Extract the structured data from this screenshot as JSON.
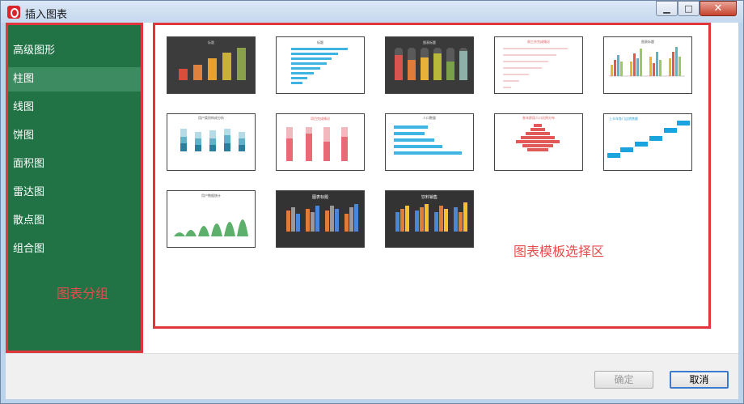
{
  "window": {
    "title": "插入图表",
    "minimize": "▁",
    "maximize": "□",
    "close": "✕"
  },
  "sidebar": {
    "items": [
      {
        "label": "高级图形"
      },
      {
        "label": "柱图"
      },
      {
        "label": "线图"
      },
      {
        "label": "饼图"
      },
      {
        "label": "面积图"
      },
      {
        "label": "雷达图"
      },
      {
        "label": "散点图"
      },
      {
        "label": "组合图"
      }
    ],
    "active_index": 1,
    "annotation": "图表分组"
  },
  "gallery": {
    "annotation": "图表模板选择区",
    "thumbs": [
      {
        "id": "t1",
        "title": "标题",
        "style": "dark-bars"
      },
      {
        "id": "t2",
        "title": "标题",
        "style": "hbars-blue"
      },
      {
        "id": "t3",
        "title": "图表标题",
        "style": "dark-capsules"
      },
      {
        "id": "t4",
        "title": "周工作完成情况",
        "style": "progress-lines"
      },
      {
        "id": "t5",
        "title": "图表标题",
        "style": "multi-bars"
      },
      {
        "id": "t6",
        "title": "用户类别构成分析",
        "style": "stacked-teal"
      },
      {
        "id": "t7",
        "title": "项目完成情况",
        "style": "stacked-pink"
      },
      {
        "id": "t8",
        "title": "人口数量",
        "style": "pictograph"
      },
      {
        "id": "t9",
        "title": "各年龄段人口比例分布",
        "style": "pyramid"
      },
      {
        "id": "t10",
        "title": "上半年各门店销售额",
        "style": "steps-blue"
      },
      {
        "id": "t11",
        "title": "用户数据统计",
        "style": "green-peaks"
      },
      {
        "id": "t12",
        "title": "图表标题",
        "style": "dark-grid-bars"
      },
      {
        "id": "t13",
        "title": "饮料销售",
        "style": "dark-yellow-bars"
      }
    ]
  },
  "footer": {
    "ok_label": "确定",
    "cancel_label": "取消"
  }
}
